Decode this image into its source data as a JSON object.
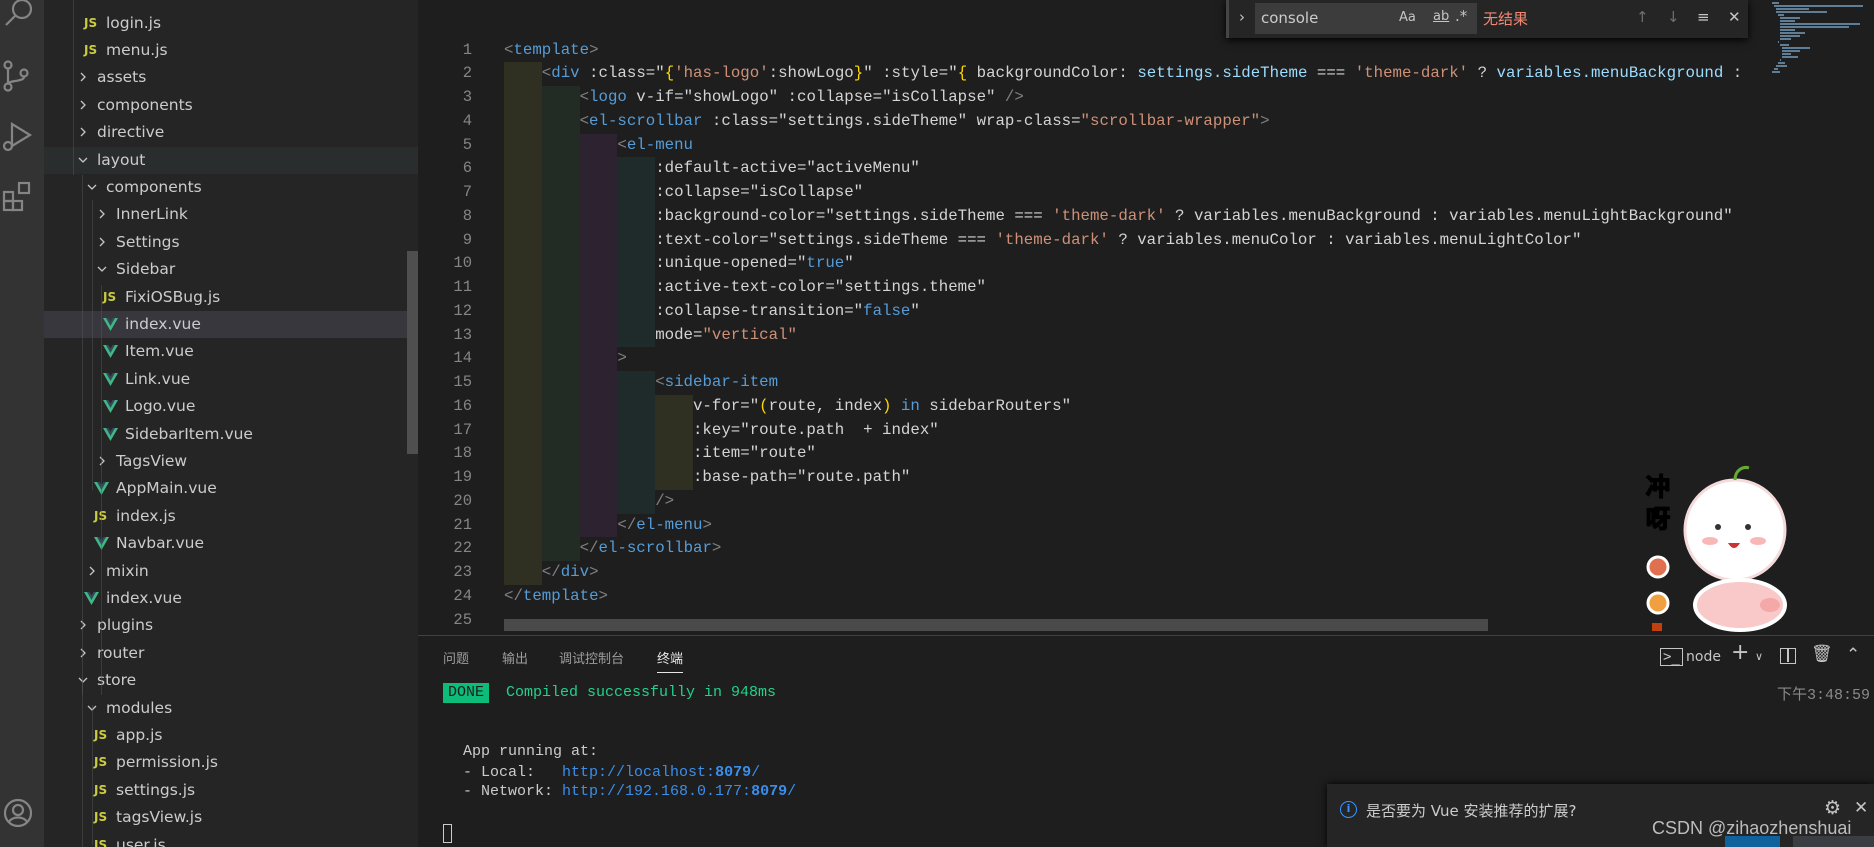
{
  "activity_bar": {
    "icons": [
      "search-icon",
      "source-control-icon",
      "run-debug-icon",
      "extensions-icon",
      "account-icon"
    ]
  },
  "explorer": {
    "items": [
      {
        "label": "login.js",
        "kind": "js",
        "level": 1
      },
      {
        "label": "menu.js",
        "kind": "js",
        "level": 1
      },
      {
        "label": "assets",
        "kind": "folder",
        "level": 0,
        "open": false
      },
      {
        "label": "components",
        "kind": "folder",
        "level": 0,
        "open": false
      },
      {
        "label": "directive",
        "kind": "folder",
        "level": 0,
        "open": false
      },
      {
        "label": "layout",
        "kind": "folder",
        "level": 0,
        "open": true,
        "state": "hover"
      },
      {
        "label": "components",
        "kind": "folder",
        "level": 1,
        "open": true
      },
      {
        "label": "InnerLink",
        "kind": "folder",
        "level": 2,
        "open": false
      },
      {
        "label": "Settings",
        "kind": "folder",
        "level": 2,
        "open": false
      },
      {
        "label": "Sidebar",
        "kind": "folder",
        "level": 2,
        "open": true
      },
      {
        "label": "FixiOSBug.js",
        "kind": "js",
        "level": 3
      },
      {
        "label": "index.vue",
        "kind": "vue",
        "level": 3,
        "state": "selected"
      },
      {
        "label": "Item.vue",
        "kind": "vue",
        "level": 3
      },
      {
        "label": "Link.vue",
        "kind": "vue",
        "level": 3
      },
      {
        "label": "Logo.vue",
        "kind": "vue",
        "level": 3
      },
      {
        "label": "SidebarItem.vue",
        "kind": "vue",
        "level": 3
      },
      {
        "label": "TagsView",
        "kind": "folder",
        "level": 2,
        "open": false
      },
      {
        "label": "AppMain.vue",
        "kind": "vue",
        "level": 2
      },
      {
        "label": "index.js",
        "kind": "js",
        "level": 2
      },
      {
        "label": "Navbar.vue",
        "kind": "vue",
        "level": 2
      },
      {
        "label": "mixin",
        "kind": "folder",
        "level": 1,
        "open": false
      },
      {
        "label": "index.vue",
        "kind": "vue",
        "level": 1
      },
      {
        "label": "plugins",
        "kind": "folder",
        "level": 0,
        "open": false
      },
      {
        "label": "router",
        "kind": "folder",
        "level": 0,
        "open": false
      },
      {
        "label": "store",
        "kind": "folder",
        "level": 0,
        "open": true
      },
      {
        "label": "modules",
        "kind": "folder",
        "level": 1,
        "open": true
      },
      {
        "label": "app.js",
        "kind": "js",
        "level": 2
      },
      {
        "label": "permission.js",
        "kind": "js",
        "level": 2
      },
      {
        "label": "settings.js",
        "kind": "js",
        "level": 2
      },
      {
        "label": "tagsView.js",
        "kind": "js",
        "level": 2
      },
      {
        "label": "user.js",
        "kind": "js",
        "level": 2
      }
    ]
  },
  "editor": {
    "lines": [
      {
        "n": "1",
        "indent": 0,
        "tokens": [
          [
            "p",
            "<"
          ],
          [
            "t",
            "template"
          ],
          [
            "p",
            ">"
          ]
        ]
      },
      {
        "n": "2",
        "indent": 1,
        "tokens": [
          [
            "p",
            "<"
          ],
          [
            "t",
            "div"
          ],
          [
            "a",
            " :class="
          ],
          [
            "w",
            "\""
          ],
          [
            "b",
            "{"
          ],
          [
            "s",
            "'has-logo'"
          ],
          [
            "w",
            ":showLogo"
          ],
          [
            "b",
            "}"
          ],
          [
            "w",
            "\""
          ],
          [
            "a",
            " :style="
          ],
          [
            "w",
            "\""
          ],
          [
            "b",
            "{"
          ],
          [
            "w",
            " backgroundColor: "
          ],
          [
            "v",
            "settings.sideTheme"
          ],
          [
            "w",
            " === "
          ],
          [
            "s",
            "'theme-dark'"
          ],
          [
            "w",
            " ? "
          ],
          [
            "v",
            "variables.menuBackground"
          ],
          [
            "w",
            " :"
          ]
        ]
      },
      {
        "n": "3",
        "indent": 2,
        "tokens": [
          [
            "p",
            "<"
          ],
          [
            "t",
            "logo"
          ],
          [
            "a",
            " v-if="
          ],
          [
            "w",
            "\"showLogo\""
          ],
          [
            "a",
            " :collapse="
          ],
          [
            "w",
            "\"isCollapse\""
          ],
          [
            "p",
            " />"
          ]
        ]
      },
      {
        "n": "4",
        "indent": 2,
        "tokens": [
          [
            "p",
            "<"
          ],
          [
            "t",
            "el-scrollbar"
          ],
          [
            "a",
            " :class="
          ],
          [
            "w",
            "\"settings.sideTheme\""
          ],
          [
            "a",
            " wrap-class="
          ],
          [
            "s",
            "\"scrollbar-wrapper\""
          ],
          [
            "p",
            ">"
          ]
        ]
      },
      {
        "n": "5",
        "indent": 3,
        "tokens": [
          [
            "p",
            "<"
          ],
          [
            "t",
            "el-menu"
          ]
        ]
      },
      {
        "n": "6",
        "indent": 4,
        "tokens": [
          [
            "a",
            ":default-active="
          ],
          [
            "w",
            "\"activeMenu\""
          ]
        ]
      },
      {
        "n": "7",
        "indent": 4,
        "tokens": [
          [
            "a",
            ":collapse="
          ],
          [
            "w",
            "\"isCollapse\""
          ]
        ]
      },
      {
        "n": "8",
        "indent": 4,
        "tokens": [
          [
            "a",
            ":background-color="
          ],
          [
            "w",
            "\"settings.sideTheme === "
          ],
          [
            "s",
            "'theme-dark'"
          ],
          [
            "w",
            " ? variables.menuBackground : variables.menuLightBackground\""
          ]
        ]
      },
      {
        "n": "9",
        "indent": 4,
        "tokens": [
          [
            "a",
            ":text-color="
          ],
          [
            "w",
            "\"settings.sideTheme === "
          ],
          [
            "s",
            "'theme-dark'"
          ],
          [
            "w",
            " ? variables.menuColor : variables.menuLightColor\""
          ]
        ]
      },
      {
        "n": "10",
        "indent": 4,
        "tokens": [
          [
            "a",
            ":unique-opened="
          ],
          [
            "w",
            "\""
          ],
          [
            "k",
            "true"
          ],
          [
            "w",
            "\""
          ]
        ]
      },
      {
        "n": "11",
        "indent": 4,
        "tokens": [
          [
            "a",
            ":active-text-color="
          ],
          [
            "w",
            "\"settings.theme\""
          ]
        ]
      },
      {
        "n": "12",
        "indent": 4,
        "tokens": [
          [
            "a",
            ":collapse-transition="
          ],
          [
            "w",
            "\""
          ],
          [
            "k",
            "false"
          ],
          [
            "w",
            "\""
          ]
        ]
      },
      {
        "n": "13",
        "indent": 4,
        "tokens": [
          [
            "a",
            "mode="
          ],
          [
            "s",
            "\"vertical\""
          ]
        ]
      },
      {
        "n": "14",
        "indent": 3,
        "tokens": [
          [
            "p",
            ">"
          ]
        ]
      },
      {
        "n": "15",
        "indent": 4,
        "tokens": [
          [
            "p",
            "<"
          ],
          [
            "t",
            "sidebar-item"
          ]
        ]
      },
      {
        "n": "16",
        "indent": 5,
        "tokens": [
          [
            "a",
            "v-for="
          ],
          [
            "w",
            "\""
          ],
          [
            "b",
            "("
          ],
          [
            "w",
            "route, index"
          ],
          [
            "b",
            ")"
          ],
          [
            "k",
            " in"
          ],
          [
            "w",
            " sidebarRouters\""
          ]
        ]
      },
      {
        "n": "17",
        "indent": 5,
        "tokens": [
          [
            "a",
            ":key="
          ],
          [
            "w",
            "\"route.path  + index\""
          ]
        ]
      },
      {
        "n": "18",
        "indent": 5,
        "tokens": [
          [
            "a",
            ":item="
          ],
          [
            "w",
            "\"route\""
          ]
        ]
      },
      {
        "n": "19",
        "indent": 5,
        "tokens": [
          [
            "a",
            ":base-path="
          ],
          [
            "w",
            "\"route.path\""
          ]
        ]
      },
      {
        "n": "20",
        "indent": 4,
        "tokens": [
          [
            "p",
            "/>"
          ]
        ]
      },
      {
        "n": "21",
        "indent": 3,
        "tokens": [
          [
            "p",
            "</"
          ],
          [
            "t",
            "el-menu"
          ],
          [
            "p",
            ">"
          ]
        ]
      },
      {
        "n": "22",
        "indent": 2,
        "tokens": [
          [
            "p",
            "</"
          ],
          [
            "t",
            "el-scrollbar"
          ],
          [
            "p",
            ">"
          ]
        ]
      },
      {
        "n": "23",
        "indent": 1,
        "tokens": [
          [
            "p",
            "</"
          ],
          [
            "t",
            "div"
          ],
          [
            "p",
            ">"
          ]
        ]
      },
      {
        "n": "24",
        "indent": 0,
        "tokens": [
          [
            "p",
            "</"
          ],
          [
            "t",
            "template"
          ],
          [
            "p",
            ">"
          ]
        ]
      },
      {
        "n": "25",
        "indent": 0,
        "tokens": []
      }
    ]
  },
  "find_widget": {
    "query": "console",
    "match_case": "Aa",
    "whole_word": "ab",
    "regex": ".*",
    "result": "无结果",
    "result_color": "#f48771"
  },
  "panel": {
    "tabs": [
      {
        "label": "问题"
      },
      {
        "label": "输出"
      },
      {
        "label": "调试控制台"
      },
      {
        "label": "终端",
        "active": true
      }
    ],
    "terminal_name": "node",
    "timestamp": "下午3:48:59",
    "done_badge": "DONE",
    "compiled": "Compiled successfully in 948ms",
    "app_running": "App running at:",
    "local_label": "- Local:   ",
    "local_url": "http://localhost:",
    "local_port": "8079",
    "network_label": "- Network: ",
    "network_url": "http://192.168.0.177:",
    "network_port": "8079",
    "url_suffix": "/",
    "accent_green": "#0dbc79"
  },
  "notification": {
    "message": "是否要为 Vue 安装推荐的扩展?"
  },
  "sticker": {
    "text_1": "冲",
    "text_2": "呀"
  },
  "watermark": "CSDN @zihaozhenshuai"
}
